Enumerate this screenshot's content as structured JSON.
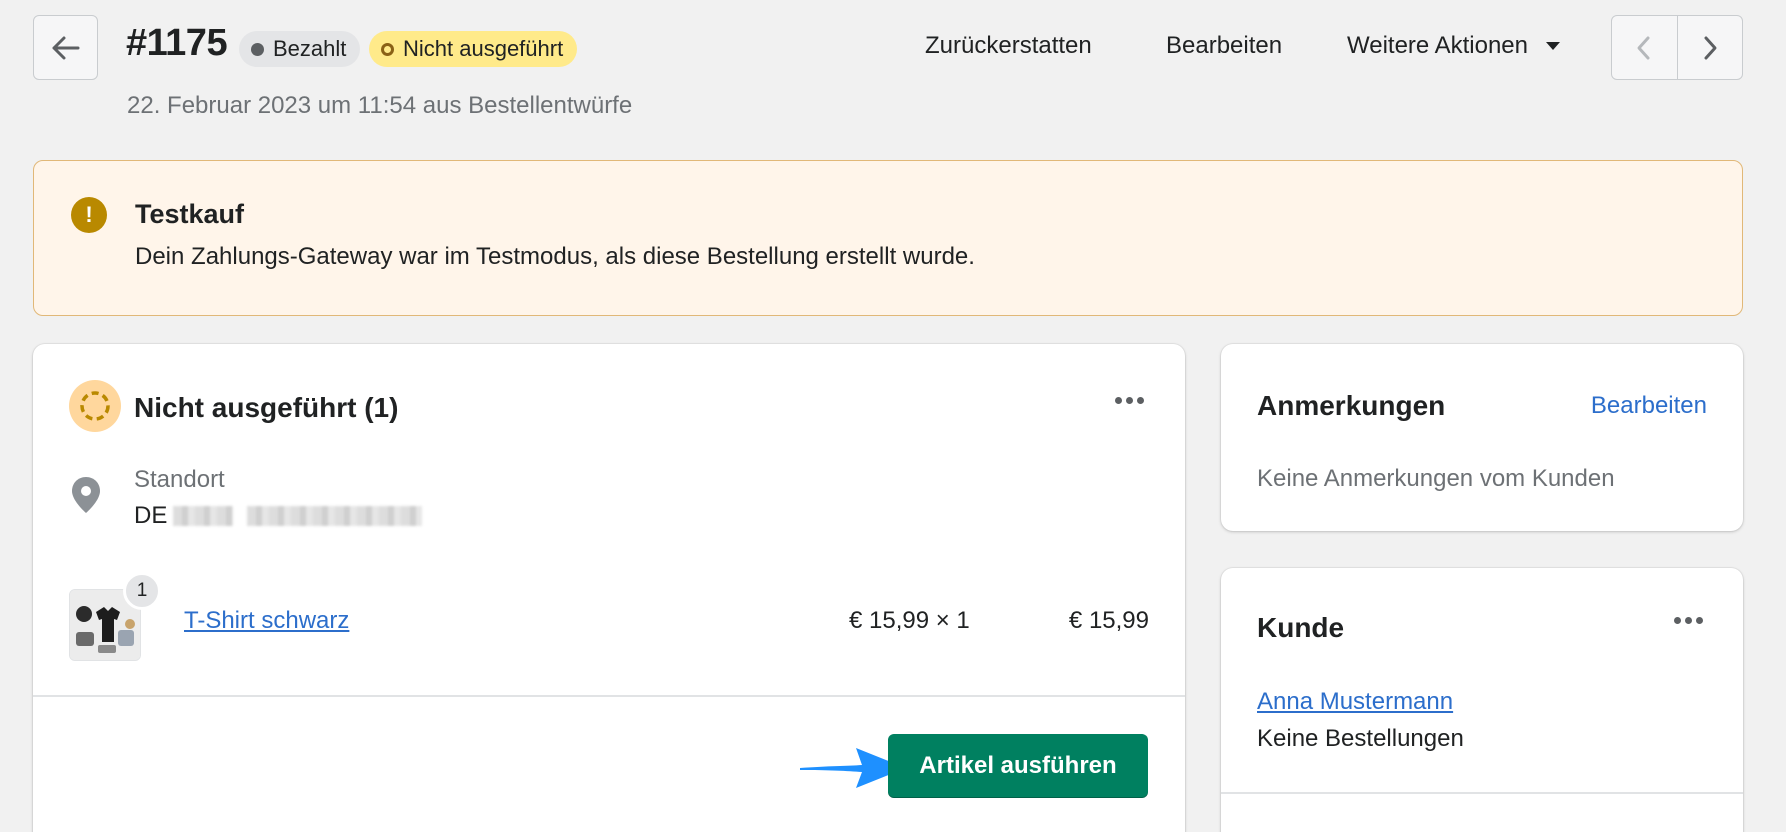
{
  "header": {
    "order_number": "#1175",
    "badges": {
      "payment": "Bezahlt",
      "fulfillment": "Nicht ausgeführt"
    },
    "date": "22. Februar 2023 um 11:54 aus Bestellentwürfe",
    "actions": {
      "refund": "Zurückerstatten",
      "edit": "Bearbeiten",
      "more": "Weitere Aktionen"
    }
  },
  "banner": {
    "icon": "exclamation-icon",
    "title": "Testkauf",
    "text": "Dein Zahlungs-Gateway war im Testmodus, als diese Bestellung erstellt wurde."
  },
  "fulfillment_card": {
    "title": "Nicht ausgeführt (1)",
    "location_label": "Standort",
    "location_value": "DE",
    "product": {
      "quantity_badge": "1",
      "name": "T-Shirt schwarz",
      "unit_price": "€ 15,99 × 1",
      "total": "€ 15,99"
    },
    "fulfill_button": "Artikel ausführen"
  },
  "notes_card": {
    "title": "Anmerkungen",
    "edit": "Bearbeiten",
    "empty": "Keine Anmerkungen vom Kunden"
  },
  "customer_card": {
    "title": "Kunde",
    "name": "Anna Mustermann",
    "orders": "Keine Bestellungen"
  },
  "colors": {
    "primary_button": "#008060",
    "link": "#2c6ecb",
    "warning_icon": "#b98900",
    "banner_bg": "#fff5ea",
    "unfulfilled_badge": "#ffea8a",
    "annotation_arrow": "#1e90ff"
  }
}
